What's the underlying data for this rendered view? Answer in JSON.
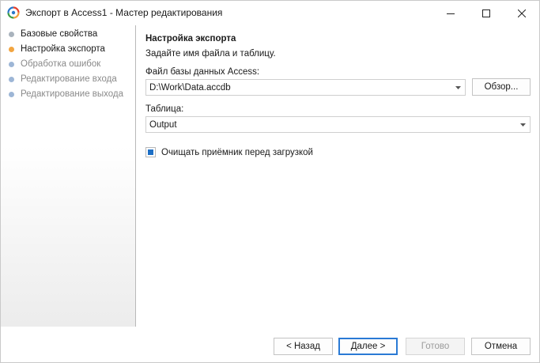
{
  "window": {
    "title": "Экспорт в Access1 - Мастер редактирования",
    "icon": "app-logo-icon"
  },
  "steps": [
    {
      "label": "Базовые свойства",
      "state": "done",
      "color": "#a9b3bd"
    },
    {
      "label": "Настройка экспорта",
      "state": "current",
      "color": "#f2a541"
    },
    {
      "label": "Обработка ошибок",
      "state": "pending",
      "color": "#9db6d6"
    },
    {
      "label": "Редактирование входа",
      "state": "pending",
      "color": "#9db6d6"
    },
    {
      "label": "Редактирование выхода",
      "state": "pending",
      "color": "#9db6d6"
    }
  ],
  "content": {
    "title": "Настройка экспорта",
    "description": "Задайте имя файла и таблицу.",
    "file_label": "Файл базы данных Access:",
    "file_value": "D:\\Work\\Data.accdb",
    "browse_label": "Обзор...",
    "table_label": "Таблица:",
    "table_value": "Output",
    "clear_label": "Очищать приёмник перед загрузкой",
    "clear_checked": true
  },
  "footer": {
    "back_label": "< Назад",
    "next_label": "Далее >",
    "finish_label": "Готово",
    "cancel_label": "Отмена"
  },
  "colors": {
    "accent": "#1e6fc5",
    "primary_border": "#2a7ad5"
  }
}
